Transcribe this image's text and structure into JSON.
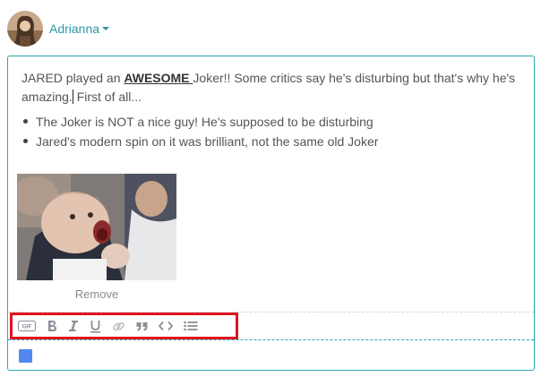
{
  "user": {
    "name": "Adrianna"
  },
  "post": {
    "text_before": "JARED played an ",
    "emphasis": "AWESOME ",
    "text_middle": "Joker!! Some critics say he's disturbing but that's why he's amazing.",
    "text_after": " First of all...",
    "bullets": [
      "The Joker is NOT a nice guy! He's supposed to be disturbing",
      "Jared's modern spin on it was brilliant, not the same old Joker"
    ]
  },
  "attachment": {
    "remove_label": "Remove"
  },
  "toolbar": {
    "gif_label": "GIF",
    "icons": [
      "gif-icon",
      "bold-icon",
      "italic-icon",
      "underline-icon",
      "link-icon",
      "quote-icon",
      "code-icon",
      "list-icon"
    ]
  },
  "colors": {
    "accent": "#2aa7b1",
    "username": "#2f96a8",
    "highlight": "#e0141e",
    "color_swatch": "#5289f0"
  }
}
